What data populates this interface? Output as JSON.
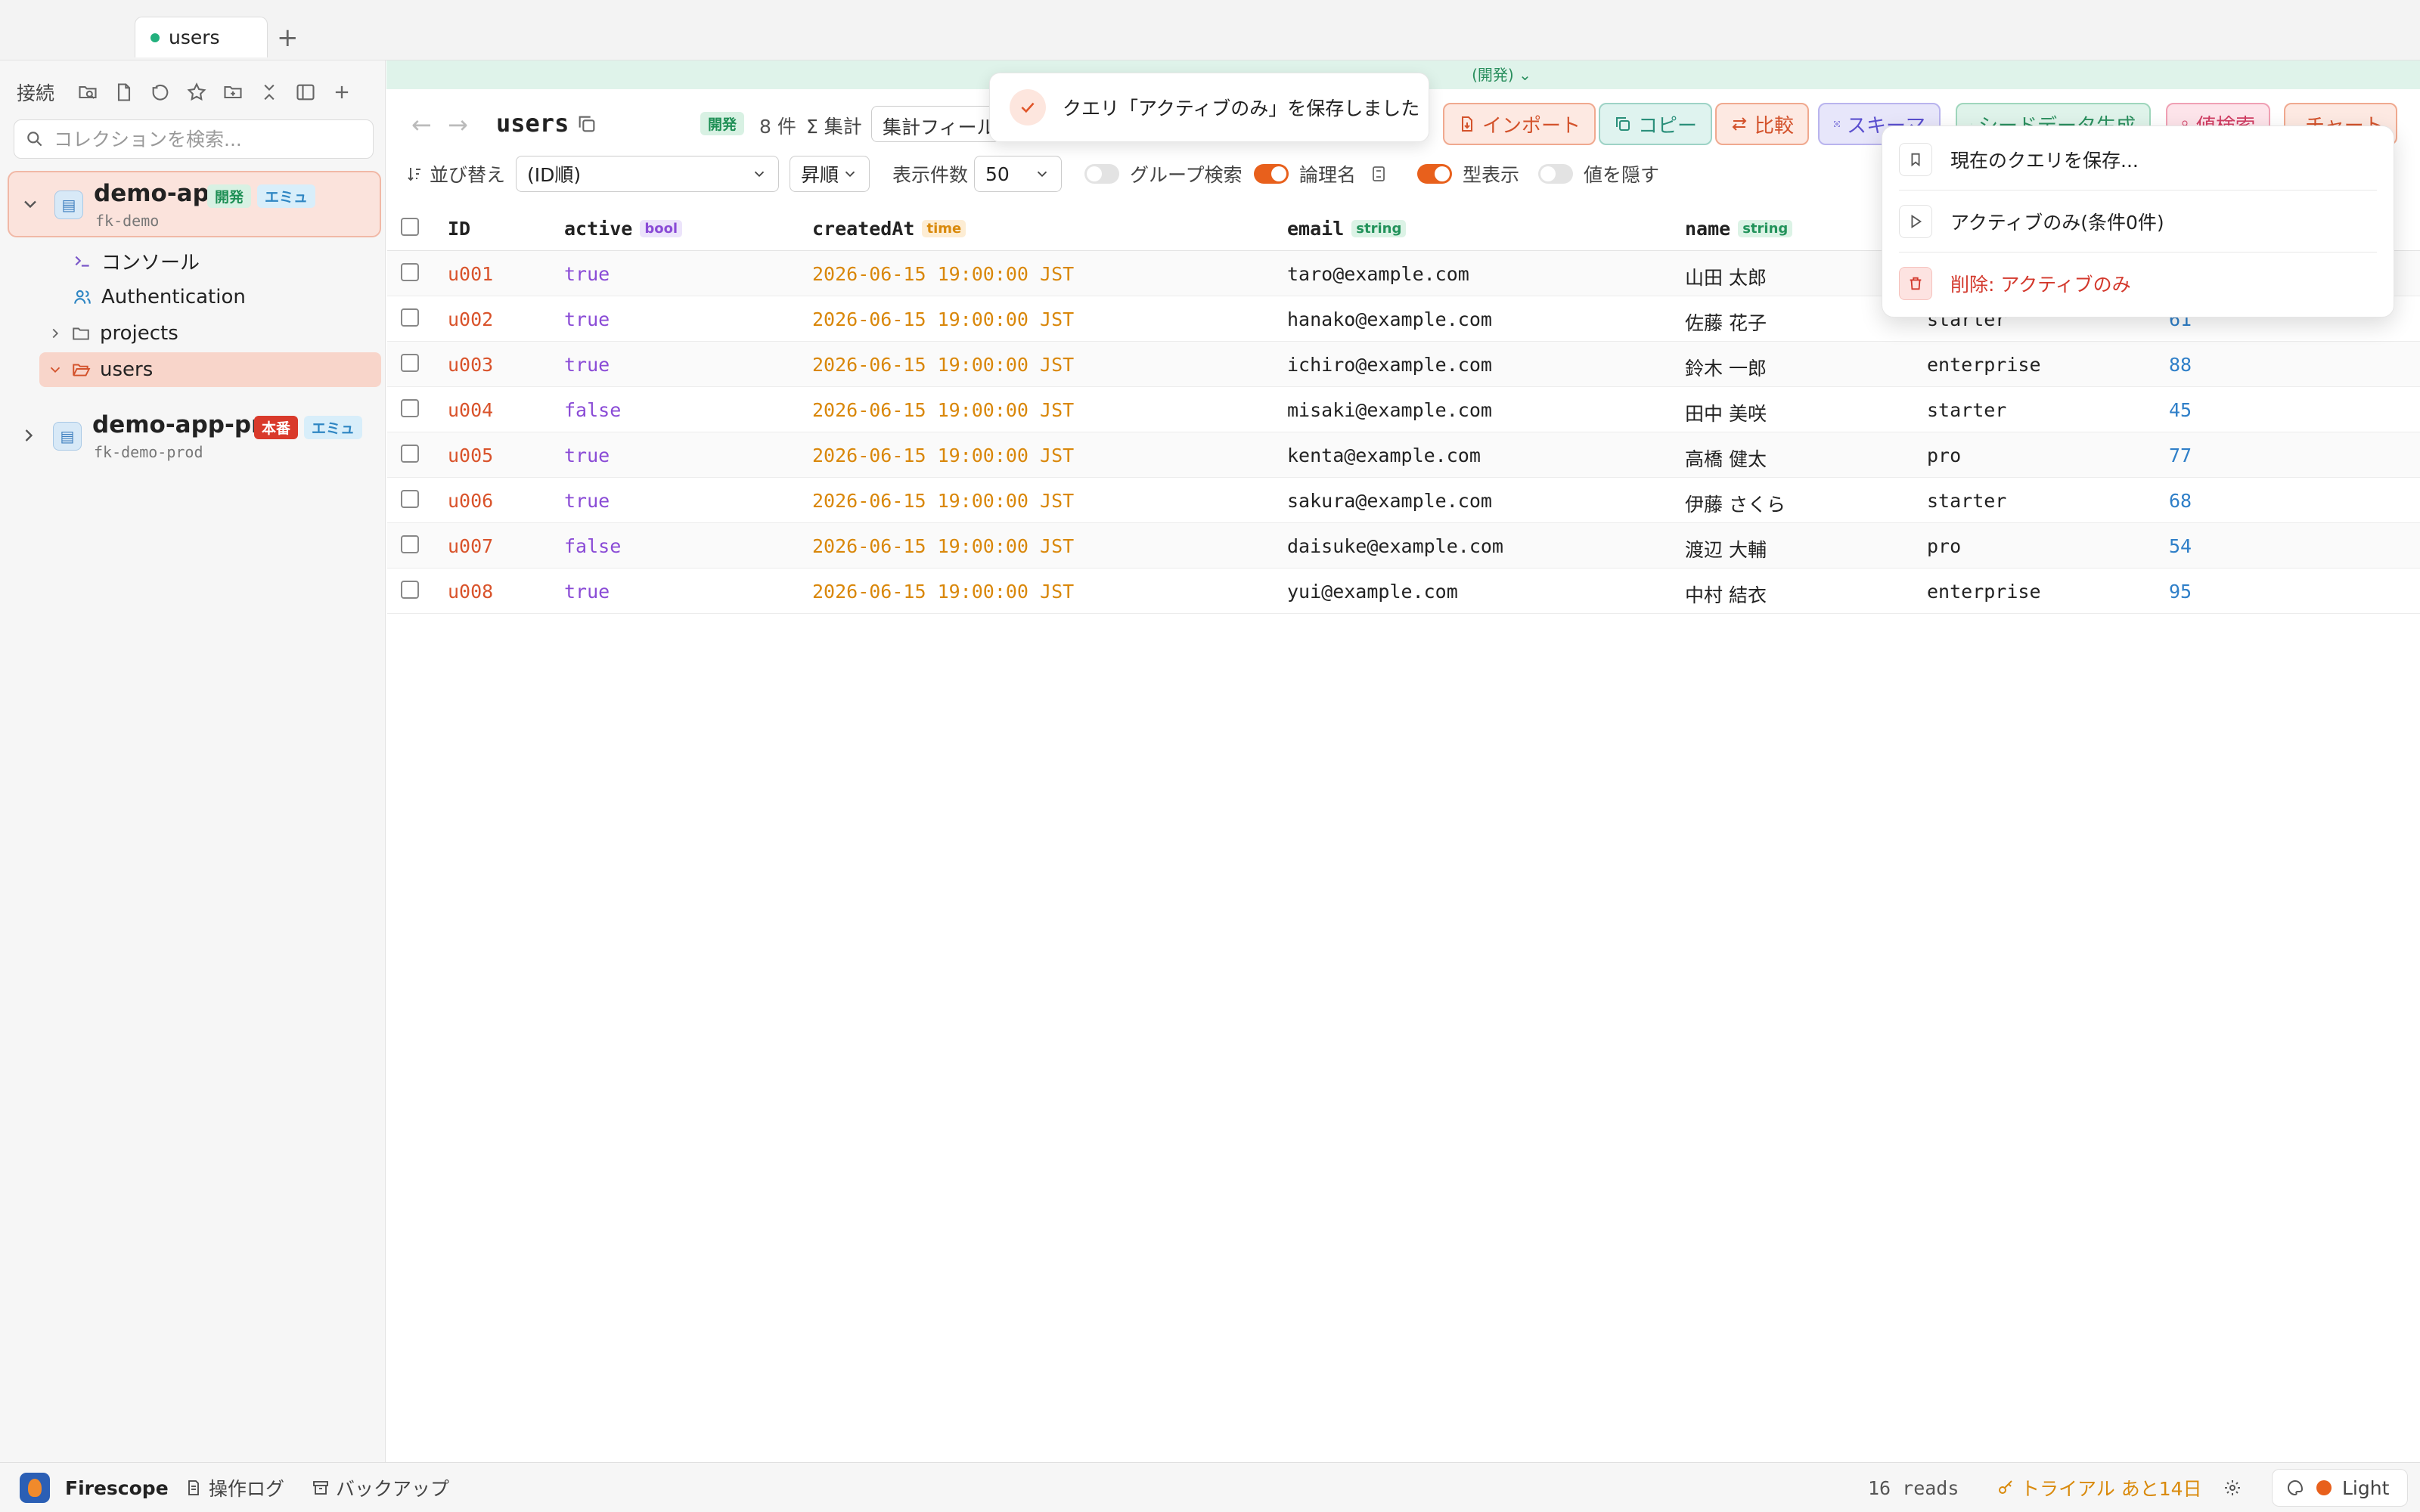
{
  "tabs": [
    {
      "label": "users"
    }
  ],
  "sidebar": {
    "title": "接続",
    "search_placeholder": "コレクションを検索...",
    "connections": [
      {
        "name": "demo-app",
        "project": "fk-demo",
        "badges": [
          "開発",
          "エミュ"
        ]
      },
      {
        "name": "demo-app-pr...",
        "project": "fk-demo-prod",
        "badges": [
          "本番",
          "エミュ"
        ]
      }
    ],
    "tree": [
      "コンソール",
      "Authentication",
      "projects",
      "users"
    ]
  },
  "env_bar": {
    "label": "(開発)"
  },
  "toolbar": {
    "collection": "users",
    "env_badge": "開発",
    "count": "8 件",
    "agg_label": "Σ 集計",
    "agg_select": "集計フィール",
    "buttons": {
      "import": "インポート",
      "copy": "コピー",
      "compare": "比較",
      "schema": "スキーマ",
      "seed": "シードデータ生成",
      "search": "値検索",
      "chart": "チャート"
    }
  },
  "toolbar2": {
    "sort_label": "並び替え",
    "sort_value": "(ID順)",
    "order_value": "昇順",
    "limit_label": "表示件数",
    "limit_value": "50",
    "group_search": "グループ検索",
    "logical_name": "論理名",
    "type_display": "型表示",
    "hide_values": "値を隠す"
  },
  "table": {
    "columns": [
      {
        "name": "ID",
        "type": ""
      },
      {
        "name": "active",
        "type": "bool"
      },
      {
        "name": "createdAt",
        "type": "time"
      },
      {
        "name": "email",
        "type": "string"
      },
      {
        "name": "name",
        "type": "string"
      }
    ],
    "rows": [
      {
        "id": "u001",
        "active": "true",
        "createdAt": "2026-06-15 19:00:00 JST",
        "email": "taro@example.com",
        "name": "山田 太郎",
        "plan": "",
        "score": ""
      },
      {
        "id": "u002",
        "active": "true",
        "createdAt": "2026-06-15 19:00:00 JST",
        "email": "hanako@example.com",
        "name": "佐藤 花子",
        "plan": "starter",
        "score": "61"
      },
      {
        "id": "u003",
        "active": "true",
        "createdAt": "2026-06-15 19:00:00 JST",
        "email": "ichiro@example.com",
        "name": "鈴木 一郎",
        "plan": "enterprise",
        "score": "88"
      },
      {
        "id": "u004",
        "active": "false",
        "createdAt": "2026-06-15 19:00:00 JST",
        "email": "misaki@example.com",
        "name": "田中 美咲",
        "plan": "starter",
        "score": "45"
      },
      {
        "id": "u005",
        "active": "true",
        "createdAt": "2026-06-15 19:00:00 JST",
        "email": "kenta@example.com",
        "name": "高橋 健太",
        "plan": "pro",
        "score": "77"
      },
      {
        "id": "u006",
        "active": "true",
        "createdAt": "2026-06-15 19:00:00 JST",
        "email": "sakura@example.com",
        "name": "伊藤 さくら",
        "plan": "starter",
        "score": "68"
      },
      {
        "id": "u007",
        "active": "false",
        "createdAt": "2026-06-15 19:00:00 JST",
        "email": "daisuke@example.com",
        "name": "渡辺 大輔",
        "plan": "pro",
        "score": "54"
      },
      {
        "id": "u008",
        "active": "true",
        "createdAt": "2026-06-15 19:00:00 JST",
        "email": "yui@example.com",
        "name": "中村 結衣",
        "plan": "enterprise",
        "score": "95"
      }
    ]
  },
  "toast": {
    "message": "クエリ「アクティブのみ」を保存しました"
  },
  "menu": {
    "save": "現在のクエリを保存...",
    "run": "アクティブのみ(条件0件)",
    "delete": "削除: アクティブのみ"
  },
  "footer": {
    "app_name": "Firescope",
    "log": "操作ログ",
    "backup": "バックアップ",
    "reads": "16 reads",
    "trial": "トライアル あと14日",
    "theme": "Light"
  }
}
